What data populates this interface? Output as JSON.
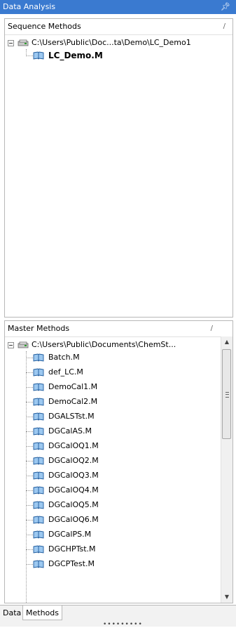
{
  "window": {
    "title": "Data Analysis",
    "pin_icon": "pin-icon"
  },
  "sequence": {
    "header": "Sequence Methods",
    "root_path": "C:\\Users\\Public\\Doc...ta\\Demo\\LC_Demo1",
    "methods": [
      "LC_Demo.M"
    ]
  },
  "master": {
    "header": "Master Methods",
    "root_path": "C:\\Users\\Public\\Documents\\ChemSt...",
    "methods": [
      "Batch.M",
      "def_LC.M",
      "DemoCal1.M",
      "DemoCal2.M",
      "DGALSTst.M",
      "DGCalAS.M",
      "DGCalOQ1.M",
      "DGCalOQ2.M",
      "DGCalOQ3.M",
      "DGCalOQ4.M",
      "DGCalOQ5.M",
      "DGCalOQ6.M",
      "DGCalPS.M",
      "DGCHPTst.M",
      "DGCPTest.M"
    ]
  },
  "tabs": [
    "Data",
    "Methods"
  ],
  "active_tab": "Methods",
  "colors": {
    "title_bar": "#3a7ad0",
    "border": "#b8b8b8"
  }
}
